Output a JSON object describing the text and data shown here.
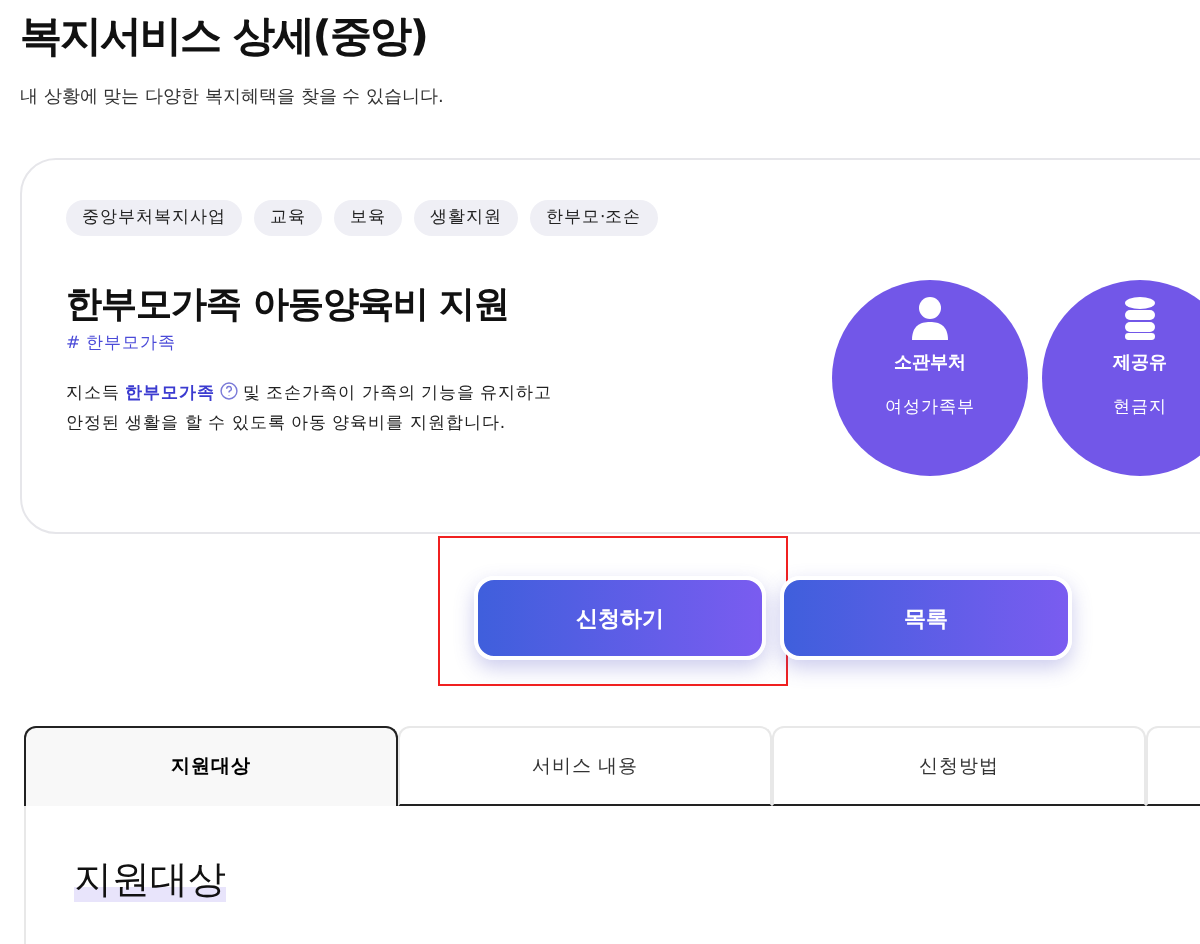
{
  "page": {
    "title": "복지서비스 상세(중앙)",
    "subtitle": "내 상황에 맞는 다양한 복지혜택을 찾을 수 있습니다."
  },
  "service": {
    "tags": [
      "중앙부처복지사업",
      "교육",
      "보육",
      "생활지원",
      "한부모·조손"
    ],
    "name": "한부모가족 아동양육비 지원",
    "hashtag": "# 한부모가족",
    "description": {
      "before": "지소득 ",
      "link": "한부모가족",
      "after": " 및 조손가족이 가족의 기능을 유지하고 안정된 생활을 할 수 있도록 아동 양육비를 지원합니다."
    },
    "info": [
      {
        "kind": "person",
        "label": "소관부처",
        "value": "여성가족부"
      },
      {
        "kind": "database",
        "label": "제공유",
        "value": "현금지"
      }
    ]
  },
  "actions": [
    {
      "label": "신청하기",
      "highlighted": true
    },
    {
      "label": "목록",
      "highlighted": false
    }
  ],
  "tabs": [
    {
      "label": "지원대상",
      "selected": true
    },
    {
      "label": "서비스 내용",
      "selected": false
    },
    {
      "label": "신청방법",
      "selected": false
    }
  ],
  "section": {
    "heading": "지원대상"
  }
}
